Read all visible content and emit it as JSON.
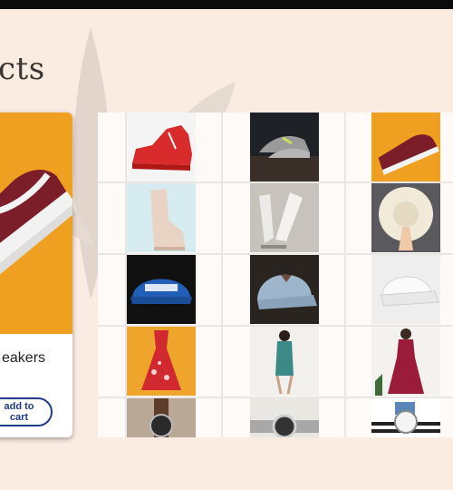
{
  "page": {
    "title": "cts"
  },
  "featured": {
    "name": "eakers",
    "cart_label": "add to cart",
    "image": "red-sneaker-on-orange"
  },
  "colors": {
    "background": "#fbece2",
    "button_accent": "#1f3c88",
    "featured_backdrop": "#f0a020",
    "sneaker_red": "#7b1e2a"
  },
  "grid": {
    "items": [
      {
        "name": "red-high-top-sneaker",
        "column": 1,
        "row": 1
      },
      {
        "name": "grey-knit-sneakers",
        "column": 2,
        "row": 1
      },
      {
        "name": "maroon-low-top-sneaker",
        "column": 4,
        "row": 1
      },
      {
        "name": "beige-lace-up-boot",
        "column": 1,
        "row": 2
      },
      {
        "name": "white-high-heels",
        "column": 2,
        "row": 2
      },
      {
        "name": "straw-sun-hat",
        "column": 4,
        "row": 2
      },
      {
        "name": "blue-embroidered-cap",
        "column": 1,
        "row": 3
      },
      {
        "name": "denim-cap",
        "column": 2,
        "row": 3
      },
      {
        "name": "white-cap",
        "column": 4,
        "row": 3
      },
      {
        "name": "red-floral-dress",
        "column": 1,
        "row": 4
      },
      {
        "name": "floral-qipao-dress",
        "column": 2,
        "row": 4
      },
      {
        "name": "maroon-midi-dress",
        "column": 4,
        "row": 4
      },
      {
        "name": "leather-strap-watch",
        "column": 1,
        "row": 5
      },
      {
        "name": "steel-wristwatch",
        "column": 2,
        "row": 5
      },
      {
        "name": "blue-strap-watch",
        "column": 4,
        "row": 5
      }
    ]
  }
}
